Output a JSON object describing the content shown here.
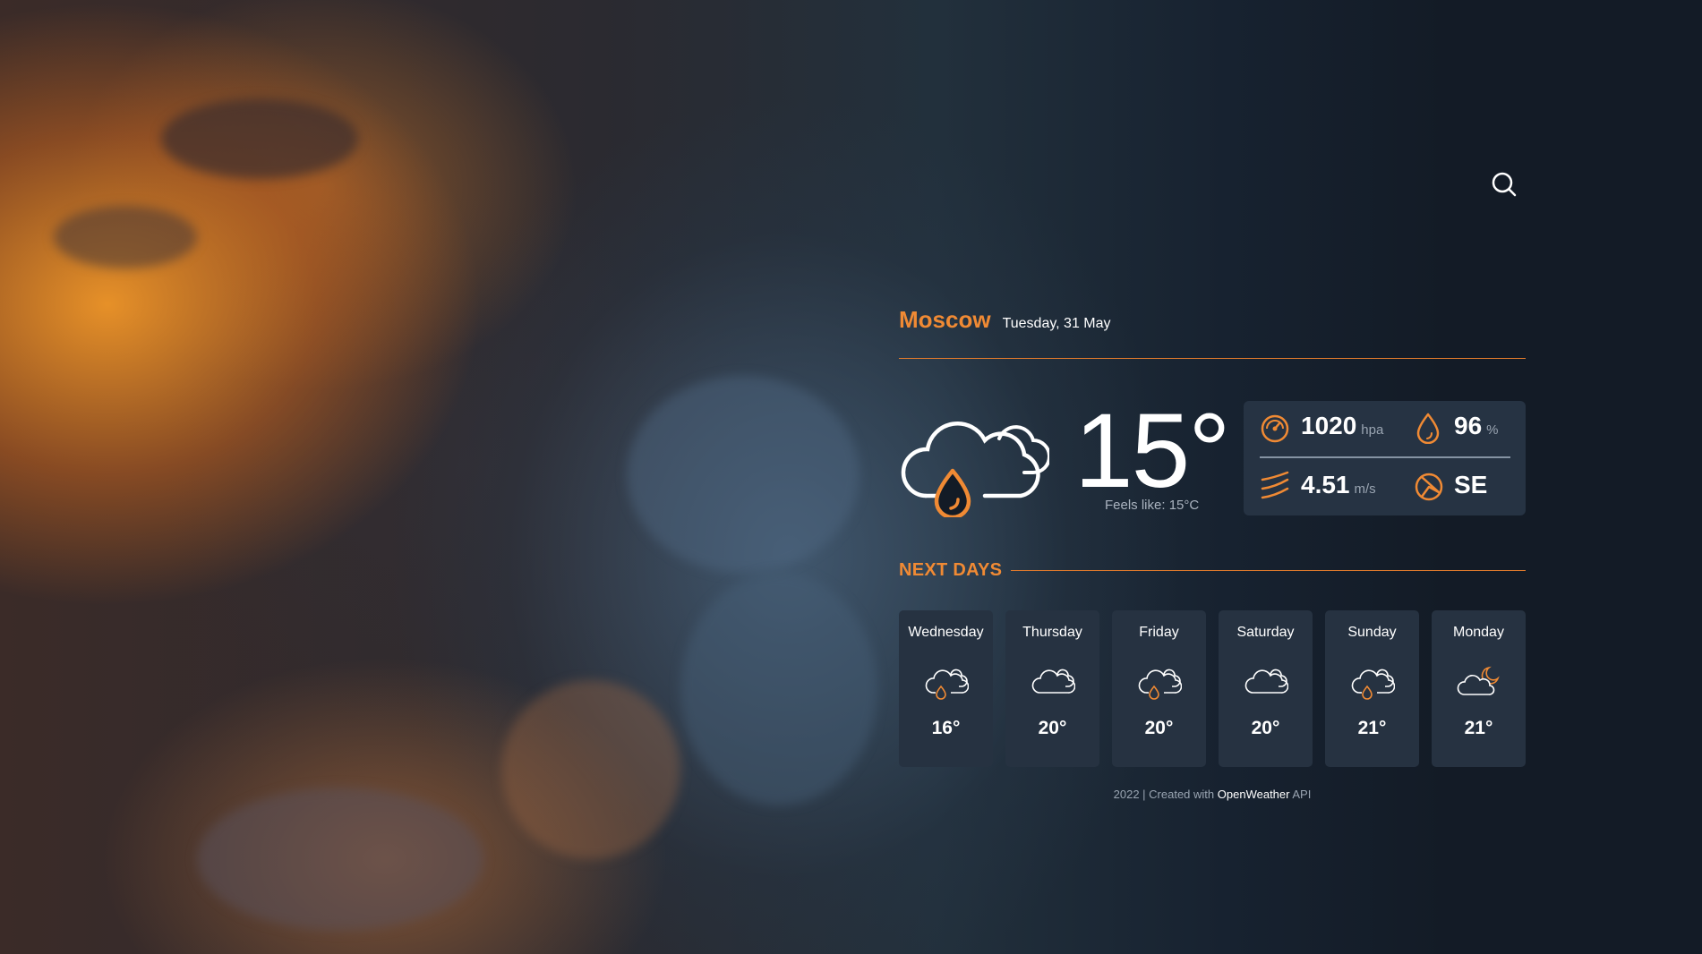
{
  "location": {
    "city": "Moscow",
    "date": "Tuesday, 31 May"
  },
  "current": {
    "temperature": "15°",
    "feels_like": "Feels like: 15°C",
    "icon": "cloud-rain-icon",
    "pressure": {
      "value": "1020",
      "unit": "hpa",
      "icon": "gauge-icon"
    },
    "humidity": {
      "value": "96",
      "unit": "%",
      "icon": "droplet-icon"
    },
    "wind": {
      "value": "4.51",
      "unit": "m/s",
      "icon": "wind-icon"
    },
    "direction": {
      "value": "SE",
      "icon": "compass-icon"
    }
  },
  "next_days": {
    "title": "NEXT DAYS",
    "days": [
      {
        "name": "Wednesday",
        "temp": "16°",
        "icon": "cloud-rain-icon"
      },
      {
        "name": "Thursday",
        "temp": "20°",
        "icon": "cloud-icon"
      },
      {
        "name": "Friday",
        "temp": "20°",
        "icon": "cloud-rain-icon"
      },
      {
        "name": "Saturday",
        "temp": "20°",
        "icon": "cloud-icon"
      },
      {
        "name": "Sunday",
        "temp": "21°",
        "icon": "cloud-rain-icon"
      },
      {
        "name": "Monday",
        "temp": "21°",
        "icon": "cloud-moon-icon"
      }
    ]
  },
  "footer": {
    "prefix": "2022 | Created with",
    "brand": "OpenWeather",
    "suffix": "API"
  },
  "colors": {
    "accent": "#f08a34",
    "background": "#131b26",
    "card": "#263241"
  }
}
